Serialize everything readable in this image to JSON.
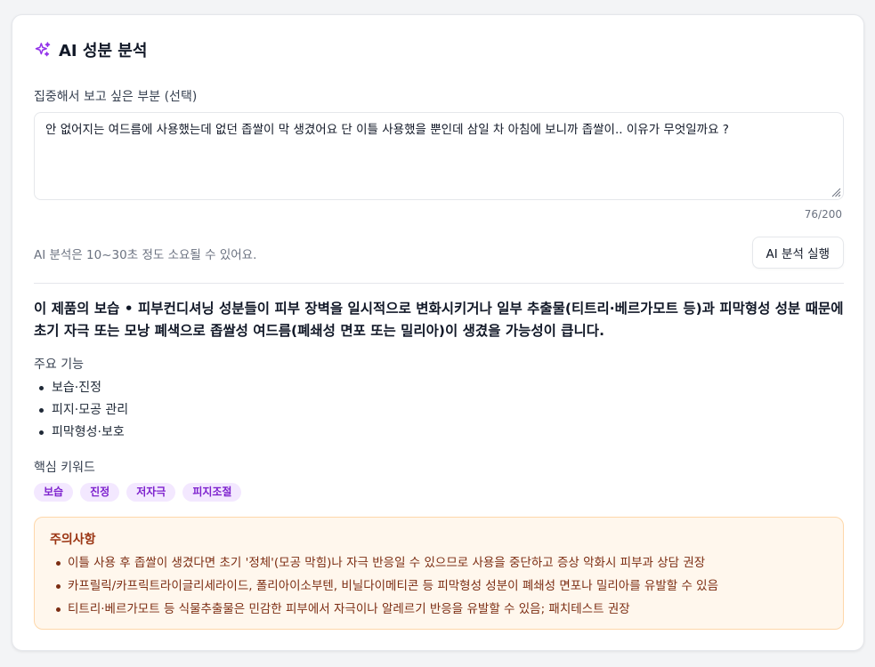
{
  "header": {
    "title": "AI 성분 분석",
    "icon": "sparkles-icon",
    "icon_color": "#9333ea"
  },
  "focus": {
    "label": "집중해서 보고 싶은 부분 (선택)",
    "value": "안 없어지는 여드름에 사용했는데 없던 좁쌀이 막 생겼어요 단 이틀 사용했을 뿐인데 삼일 차 아침에 보니까 좁쌀이.. 이유가 무엇일까요 ?",
    "char_count": "76/200"
  },
  "run": {
    "hint": "AI 분석은 10~30초 정도 소요될 수 있어요.",
    "button_label": "AI 분석 실행"
  },
  "result": {
    "summary": "이 제품의 보습 • 피부컨디셔닝 성분들이 피부 장벽을 일시적으로 변화시키거나 일부 추출물(티트리·베르가모트 등)과 피막형성 성분 때문에 초기 자극 또는 모낭 폐색으로 좁쌀성 여드름(폐쇄성 면포 또는 밀리아)이 생겼을 가능성이 큽니다.",
    "functions_label": "주요 기능",
    "functions": [
      "보습·진정",
      "피지·모공 관리",
      "피막형성·보호"
    ],
    "keywords_label": "핵심 키워드",
    "keywords": [
      "보습",
      "진정",
      "저자극",
      "피지조절"
    ],
    "caution": {
      "title": "주의사항",
      "items": [
        "이틀 사용 후 좁쌀이 생겼다면 초기 '정체'(모공 막힘)나 자극 반응일 수 있으므로 사용을 중단하고 증상 악화시 피부과 상담 권장",
        "카프릴릭/카프릭트라이글리세라이드, 폴리아이소부텐, 비닐다이메티콘 등 피막형성 성분이 폐쇄성 면포나 밀리아를 유발할 수 있음",
        "티트리·베르가모트 등 식물추출물은 민감한 피부에서 자극이나 알레르기 반응을 유발할 수 있음; 패치테스트 권장"
      ]
    }
  },
  "colors": {
    "accent_purple": "#9333ea",
    "tag_bg": "#f3e8ff",
    "tag_text": "#7e22ce",
    "caution_bg": "#fff7ed",
    "caution_border": "#fed7aa",
    "caution_text": "#9a3412"
  }
}
